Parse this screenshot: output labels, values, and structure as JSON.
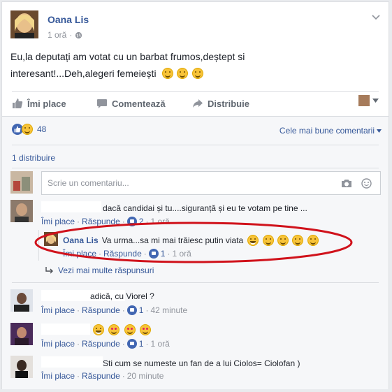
{
  "post": {
    "author": "Oana Lis",
    "time": "1 oră",
    "text_line1": "Eu,la deputați am votat cu un barbat frumos,deștept si",
    "text_line2": "interesant!...Deh,alegeri femeiești"
  },
  "actions": {
    "like": "Îmi place",
    "comment": "Comentează",
    "share": "Distribuie"
  },
  "reactions": {
    "count": "48"
  },
  "sort_label": "Cele mai bune comentarii",
  "shares": "1 distribuire",
  "comment_box": {
    "placeholder": "Scrie un comentariu..."
  },
  "comments": [
    {
      "text": "dacă candidai și tu....siguranță și eu te votam pe tine ...",
      "like": "Îmi place",
      "reply": "Răspunde",
      "likes": "2",
      "time": "1 oră",
      "reply_item": {
        "author": "Oana Lis",
        "text": "Va urma...sa mi mai trăiesc putin viata",
        "like": "Îmi place",
        "reply": "Răspunde",
        "likes": "1",
        "time": "1 oră"
      },
      "more_replies": "Vezi mai multe răspunsuri"
    },
    {
      "text": "adică, cu Viorel ?",
      "like": "Îmi place",
      "reply": "Răspunde",
      "likes": "1",
      "time": "42 minute"
    },
    {
      "text": "",
      "like": "Îmi place",
      "reply": "Răspunde",
      "likes": "1",
      "time": "1 oră"
    },
    {
      "text": "Sti cum se numeste un fan de a lui Ciolos= Ciolofan )",
      "like": "Îmi place",
      "reply": "Răspunde",
      "time": "20 minute"
    }
  ],
  "colors": {
    "accent": "#4267b2",
    "link": "#365899",
    "highlight_oval": "#d0121b"
  }
}
